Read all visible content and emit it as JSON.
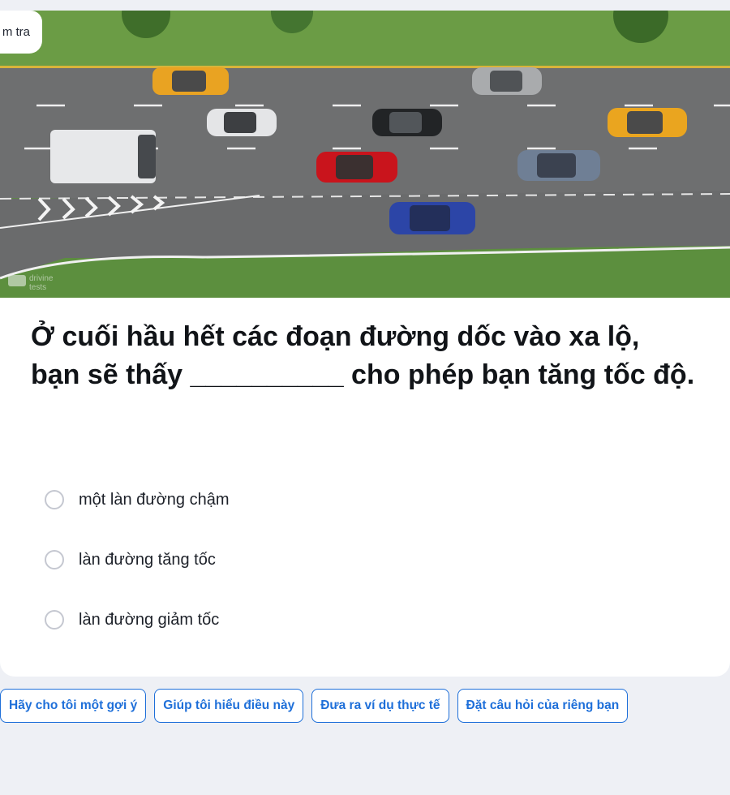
{
  "top_tab": {
    "label": "m tra"
  },
  "image": {
    "alt": "drivine tests",
    "watermark_line1": "drivine",
    "watermark_line2": "tests"
  },
  "question": {
    "text": "Ở cuối hầu hết các đoạn đường dốc vào xa lộ, bạn sẽ thấy __________ cho phép bạn tăng tốc độ."
  },
  "options": [
    {
      "label": "một làn đường chậm"
    },
    {
      "label": "làn đường tăng tốc"
    },
    {
      "label": "làn đường giảm tốc"
    }
  ],
  "suggestions": [
    {
      "label": "Hãy cho tôi một gợi ý"
    },
    {
      "label": "Giúp tôi hiểu điều này"
    },
    {
      "label": "Đưa ra ví dụ thực tế"
    },
    {
      "label": "Đặt câu hỏi của riêng bạn"
    }
  ],
  "colors": {
    "accent": "#1e6fd9",
    "background": "#eef0f5",
    "card": "#ffffff"
  }
}
